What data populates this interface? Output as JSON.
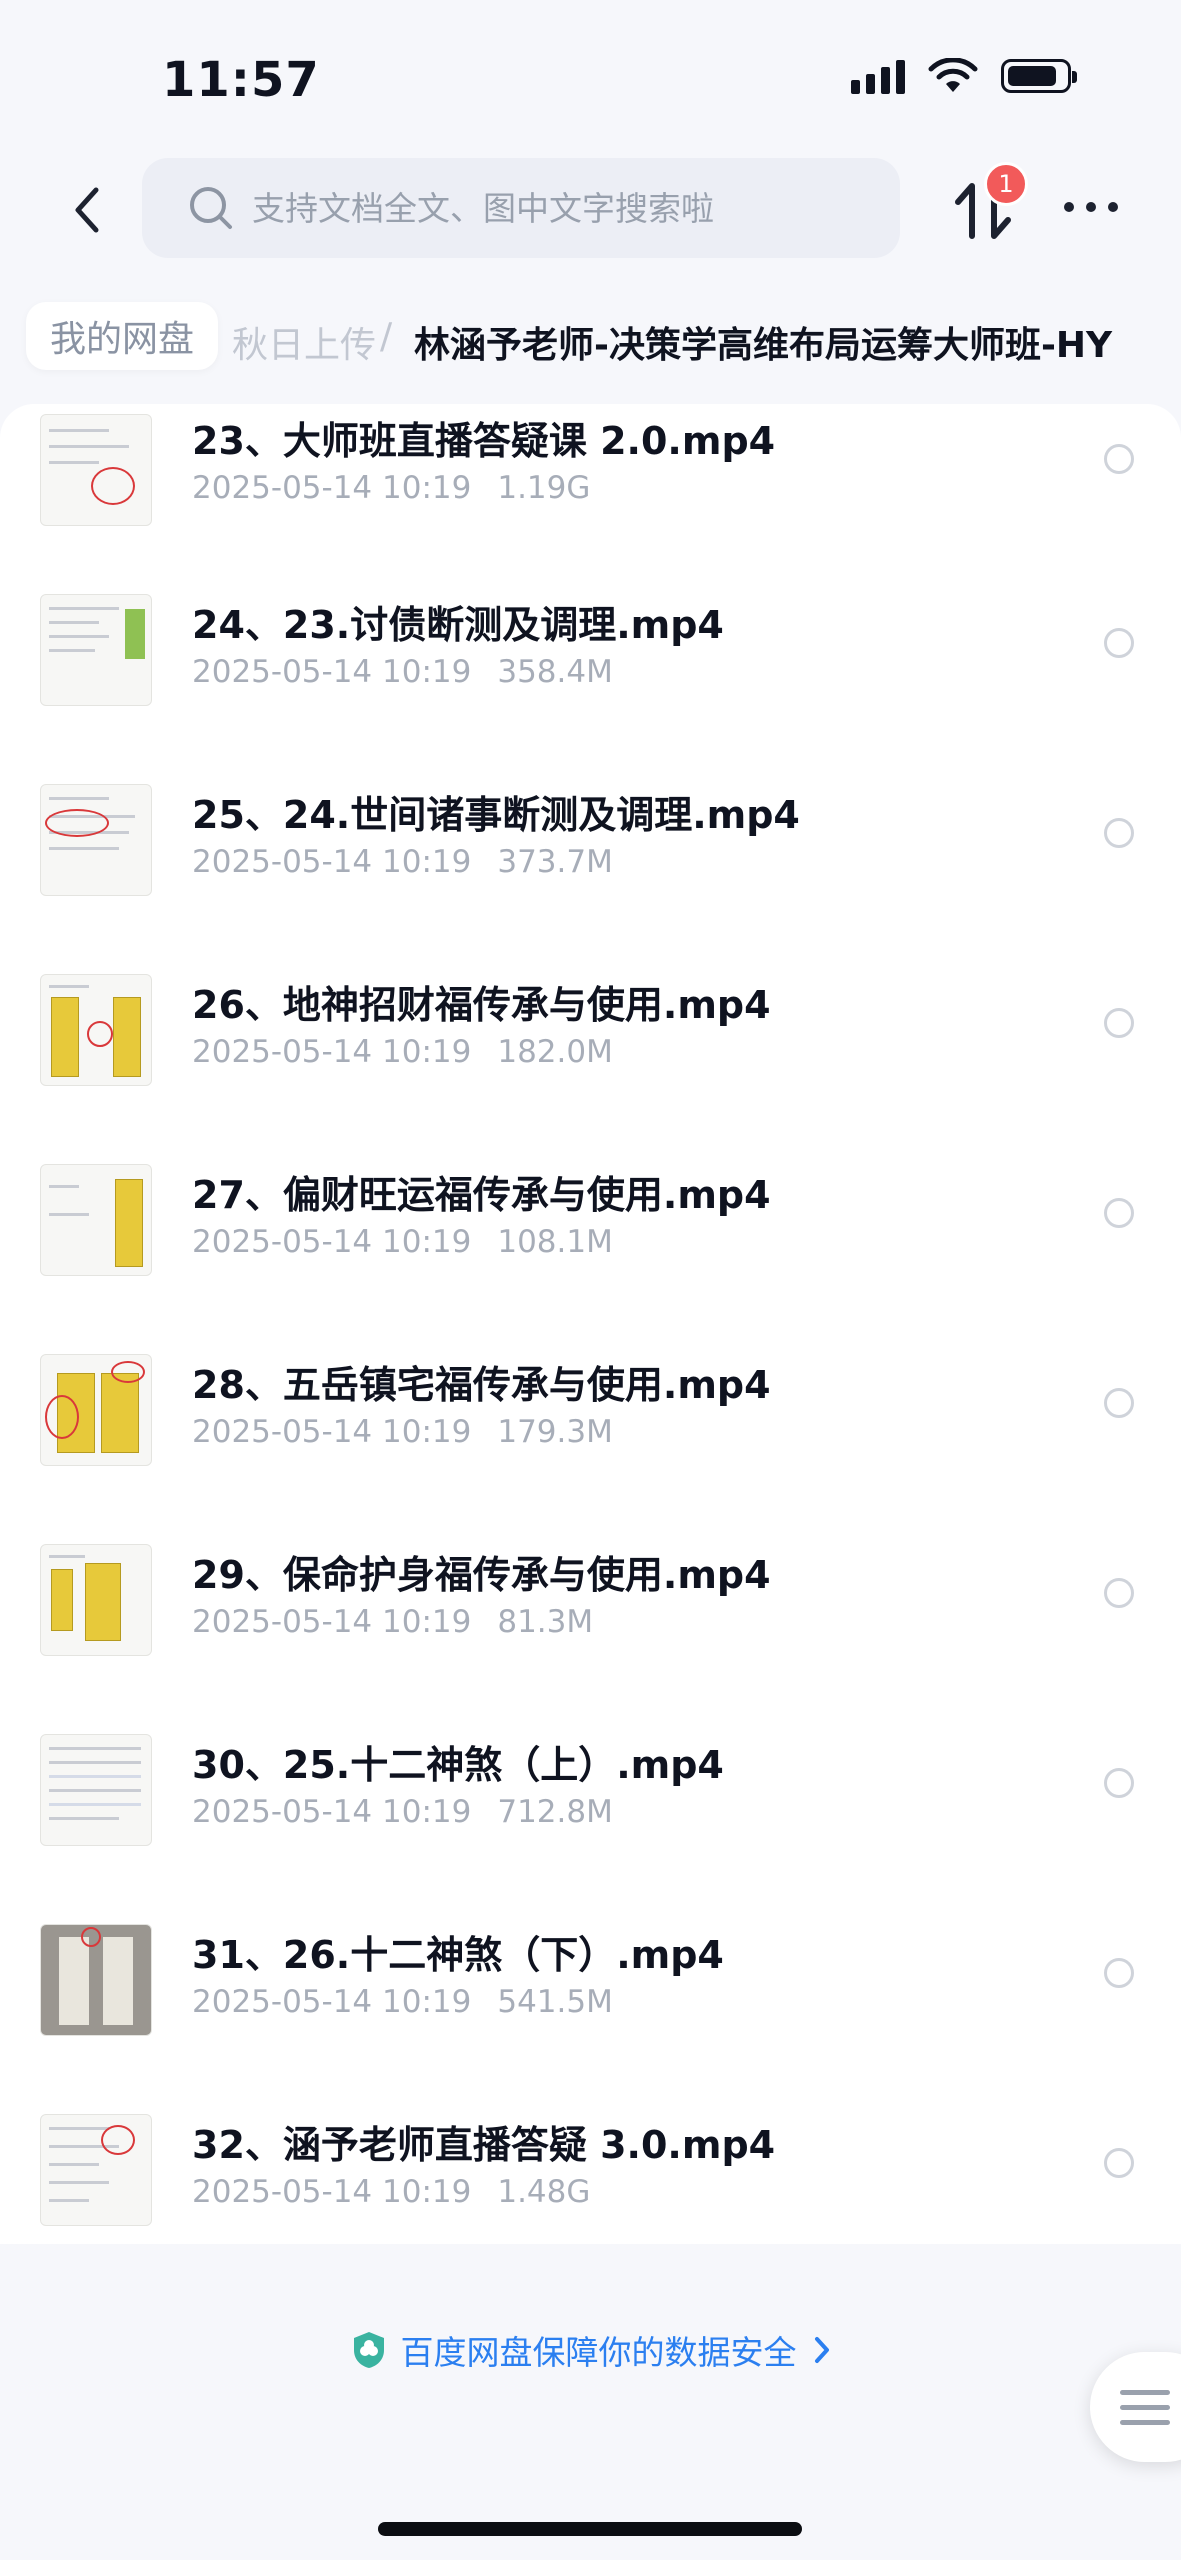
{
  "status_bar": {
    "time": "11:57"
  },
  "search": {
    "placeholder": "支持文档全文、图中文字搜索啦"
  },
  "transfer": {
    "badge_count": "1"
  },
  "breadcrumb": {
    "home": "我的网盘",
    "middle": "秋日上传",
    "separator": "/",
    "current": "林涵予老师-决策学高维布局运筹大师班-HY"
  },
  "files": [
    {
      "name": "23、大师班直播答疑课 2.0.mp4",
      "date": "2025-05-14 10:19",
      "size": "1.19G"
    },
    {
      "name": "24、23.讨债断测及调理.mp4",
      "date": "2025-05-14 10:19",
      "size": "358.4M"
    },
    {
      "name": "25、24.世间诸事断测及调理.mp4",
      "date": "2025-05-14 10:19",
      "size": "373.7M"
    },
    {
      "name": "26、地神招财福传承与使用.mp4",
      "date": "2025-05-14 10:19",
      "size": "182.0M"
    },
    {
      "name": "27、偏财旺运福传承与使用.mp4",
      "date": "2025-05-14 10:19",
      "size": "108.1M"
    },
    {
      "name": "28、五岳镇宅福传承与使用.mp4",
      "date": "2025-05-14 10:19",
      "size": "179.3M"
    },
    {
      "name": "29、保命护身福传承与使用.mp4",
      "date": "2025-05-14 10:19",
      "size": "81.3M"
    },
    {
      "name": "30、25.十二神煞（上）.mp4",
      "date": "2025-05-14 10:19",
      "size": "712.8M"
    },
    {
      "name": "31、26.十二神煞（下）.mp4",
      "date": "2025-05-14 10:19",
      "size": "541.5M"
    },
    {
      "name": "32、涵予老师直播答疑 3.0.mp4",
      "date": "2025-05-14 10:19",
      "size": "1.48G"
    }
  ],
  "footer": {
    "secure_text": "百度网盘保障你的数据安全"
  },
  "colors": {
    "accent": "#2b7ff0",
    "badge": "#f25a5a",
    "talisman": "#e7c93a"
  }
}
